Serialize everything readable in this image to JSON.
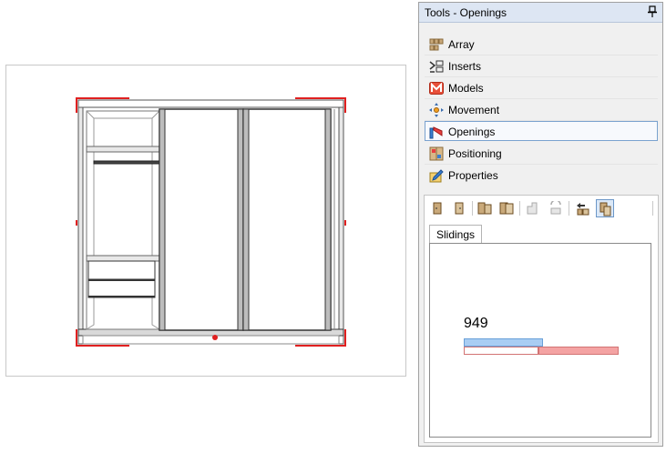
{
  "panel": {
    "title": "Tools - Openings",
    "menu": [
      {
        "label": "Array",
        "icon": "array-icon"
      },
      {
        "label": "Inserts",
        "icon": "inserts-icon"
      },
      {
        "label": "Models",
        "icon": "models-icon"
      },
      {
        "label": "Movement",
        "icon": "movement-icon"
      },
      {
        "label": "Openings",
        "icon": "openings-icon",
        "selected": true
      },
      {
        "label": "Positioning",
        "icon": "positioning-icon"
      },
      {
        "label": "Properties",
        "icon": "properties-icon"
      }
    ],
    "tab": "Slidings",
    "width_value": "949",
    "blue_bar_fraction": 0.51,
    "red_bar_fraction": 0.52
  },
  "colors": {
    "accent_blue": "#6aa0d8",
    "accent_red": "#e02020",
    "selection_border": "#7aa2cf"
  }
}
